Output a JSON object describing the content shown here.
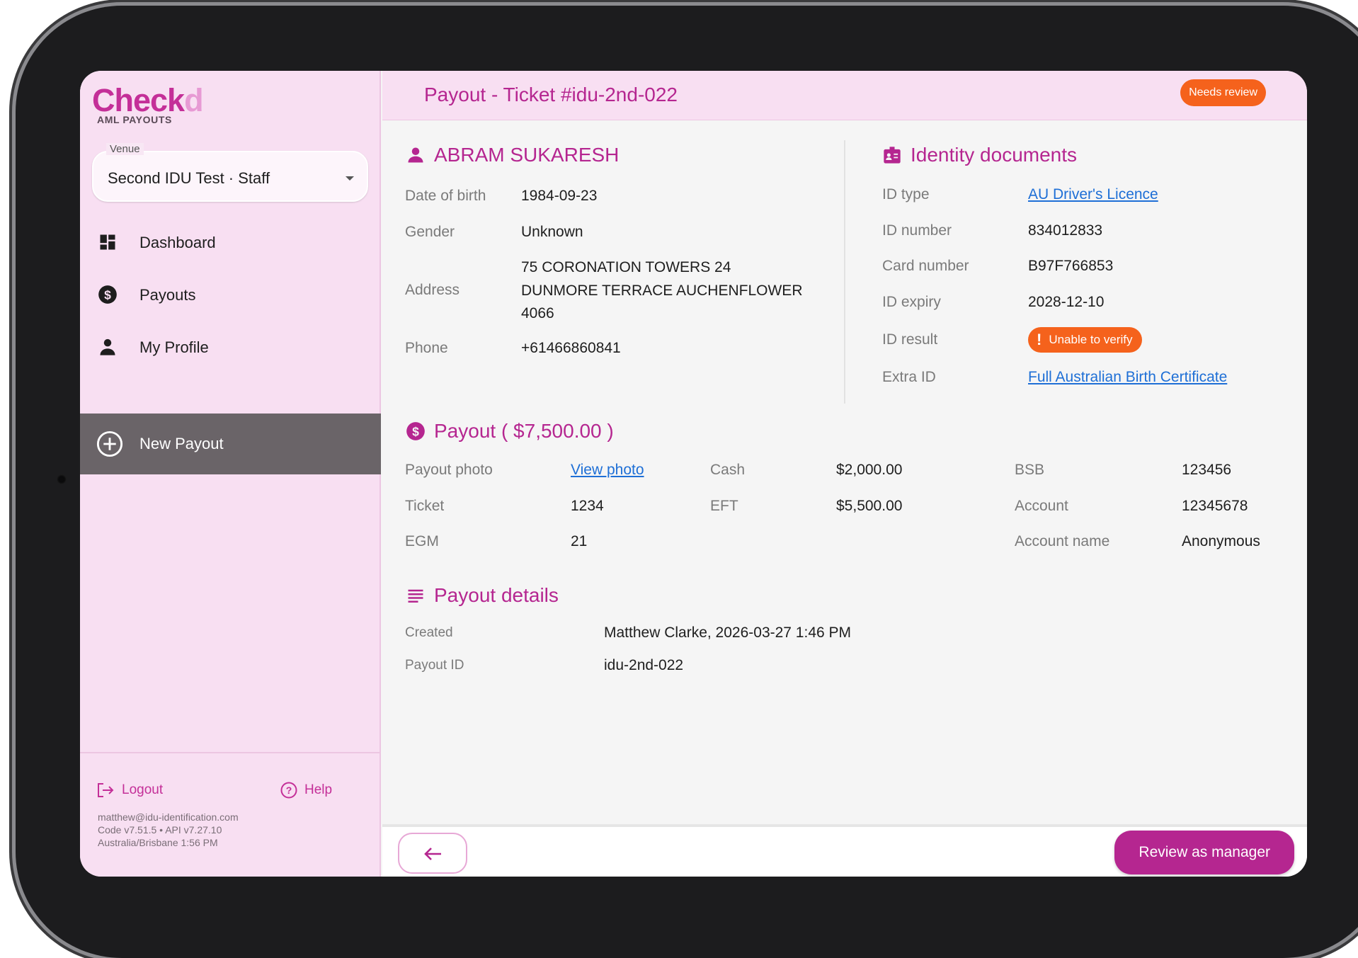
{
  "app": {
    "logo_main": "Check",
    "logo_accent": "d",
    "subtitle": "AML PAYOUTS",
    "brand_color": "#c42f98"
  },
  "venue": {
    "label": "Venue",
    "value": "Second IDU Test · Staff"
  },
  "nav": {
    "dashboard": "Dashboard",
    "payouts": "Payouts",
    "profile": "My Profile",
    "new_payout": "New Payout"
  },
  "footer": {
    "logout": "Logout",
    "help": "Help",
    "email": "matthew@idu-identification.com",
    "version": "Code v7.51.5 • API v7.27.10",
    "timezone": "Australia/Brisbane 1:56 PM"
  },
  "header": {
    "title": "Payout - Ticket #idu-2nd-022",
    "status": "Needs review",
    "status_color": "#f5621c"
  },
  "person": {
    "name": "ABRAM SUKARESH",
    "dob_label": "Date of birth",
    "dob": "1984-09-23",
    "gender_label": "Gender",
    "gender": "Unknown",
    "address_label": "Address",
    "address_line1": "75 CORONATION TOWERS 24",
    "address_line2": "DUNMORE TERRACE AUCHENFLOWER",
    "address_line3": "4066",
    "phone_label": "Phone",
    "phone": "+61466860841"
  },
  "identity": {
    "title": "Identity documents",
    "id_type_label": "ID type",
    "id_type": "AU Driver's Licence",
    "id_number_label": "ID number",
    "id_number": "834012833",
    "card_number_label": "Card number",
    "card_number": "B97F766853",
    "expiry_label": "ID expiry",
    "expiry": "2028-12-10",
    "result_label": "ID result",
    "result": "Unable to verify",
    "extra_label": "Extra ID",
    "extra": "Full Australian Birth Certificate"
  },
  "payout": {
    "title": "Payout ( $7,500.00 )",
    "photo_label": "Payout photo",
    "photo_link": "View photo",
    "ticket_label": "Ticket",
    "ticket": "1234",
    "egm_label": "EGM",
    "egm": "21",
    "cash_label": "Cash",
    "cash": "$2,000.00",
    "eft_label": "EFT",
    "eft": "$5,500.00",
    "bsb_label": "BSB",
    "bsb": "123456",
    "account_label": "Account",
    "account": "12345678",
    "account_name_label": "Account name",
    "account_name": "Anonymous"
  },
  "details": {
    "title": "Payout details",
    "created_label": "Created",
    "created": "Matthew Clarke, 2026-03-27 1:46 PM",
    "id_label": "Payout ID",
    "id": "idu-2nd-022"
  },
  "actions": {
    "review": "Review as manager"
  }
}
